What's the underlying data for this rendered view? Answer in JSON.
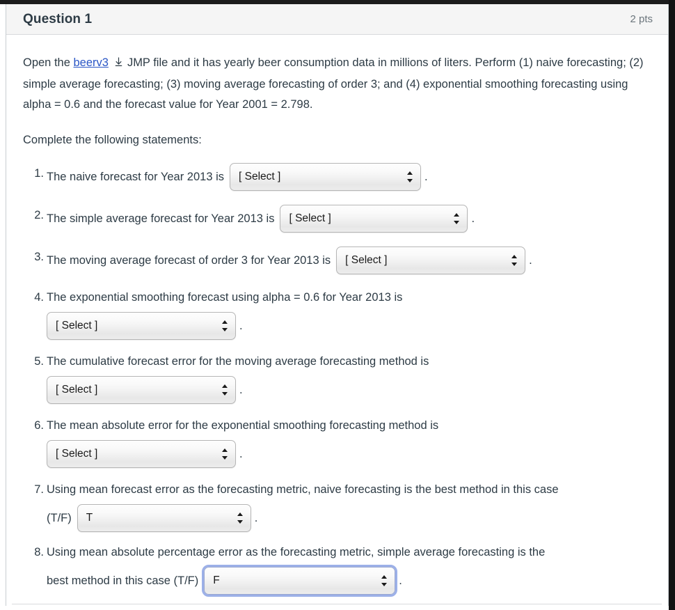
{
  "window": {
    "chrome_top_color": "#1c1c1c",
    "chrome_right_color": "#131313"
  },
  "header": {
    "title": "Question 1",
    "points": "2 pts",
    "background": "#f5f5f5"
  },
  "prompt": {
    "intro_before_link": "Open the ",
    "link_label": "beerv3",
    "link_color": "#2a56c6",
    "download_icon": "download-icon",
    "intro_after_link": "JMP file and it has yearly beer consumption data in millions of liters.   Perform (1) naive forecasting; (2) simple average forecasting; (3) moving average forecasting of order 3; and (4) exponential smoothing forecasting using alpha = 0.6 and the forecast value for Year 2001 = 2.798.",
    "instruction": "Complete the following statements:"
  },
  "select_placeholder": "[ Select ]",
  "focus_ring_color": "#9cb0e8",
  "statements": [
    {
      "number": "1.",
      "text_before": "The naive forecast for Year 2013 is",
      "text_second_line": "",
      "select_value": "[ Select ]",
      "select_name": "naive-forecast-select",
      "focused": false,
      "trailing": "."
    },
    {
      "number": "2.",
      "text_before": "The simple average forecast for Year 2013 is",
      "text_second_line": "",
      "select_value": "[ Select ]",
      "select_name": "simple-average-forecast-select",
      "focused": false,
      "trailing": "."
    },
    {
      "number": "3.",
      "text_before": "The moving average forecast of order 3 for Year 2013 is",
      "text_second_line": "",
      "select_value": "[ Select ]",
      "select_name": "moving-average-forecast-select",
      "focused": false,
      "trailing": "."
    },
    {
      "number": "4.",
      "text_before": "The exponential smoothing forecast using alpha = 0.6 for Year 2013 is",
      "text_second_line": "",
      "select_value": "[ Select ]",
      "select_name": "exponential-smoothing-forecast-select",
      "focused": false,
      "trailing": "."
    },
    {
      "number": "5.",
      "text_before": "The cumulative forecast error for the moving average forecasting method is",
      "text_second_line": "",
      "select_value": "[ Select ]",
      "select_name": "cumulative-forecast-error-select",
      "focused": false,
      "trailing": "."
    },
    {
      "number": "6.",
      "text_before": "The mean absolute error for the exponential smoothing forecasting method is",
      "text_second_line": "",
      "select_value": "[ Select ]",
      "select_name": "mean-absolute-error-select",
      "focused": false,
      "trailing": "."
    },
    {
      "number": "7.",
      "text_before": "Using mean forecast error as the forecasting metric, naive forecasting is the best method in this case",
      "text_second_line": "(T/F)",
      "select_value": "T",
      "select_name": "naive-best-method-select",
      "focused": false,
      "trailing": "."
    },
    {
      "number": "8.",
      "text_before": "Using mean absolute percentage error as the forecasting metric, simple average forecasting is the",
      "text_second_line": "best method in this case (T/F)",
      "select_value": "F",
      "select_name": "simple-average-best-method-select",
      "focused": true,
      "trailing": "."
    }
  ]
}
